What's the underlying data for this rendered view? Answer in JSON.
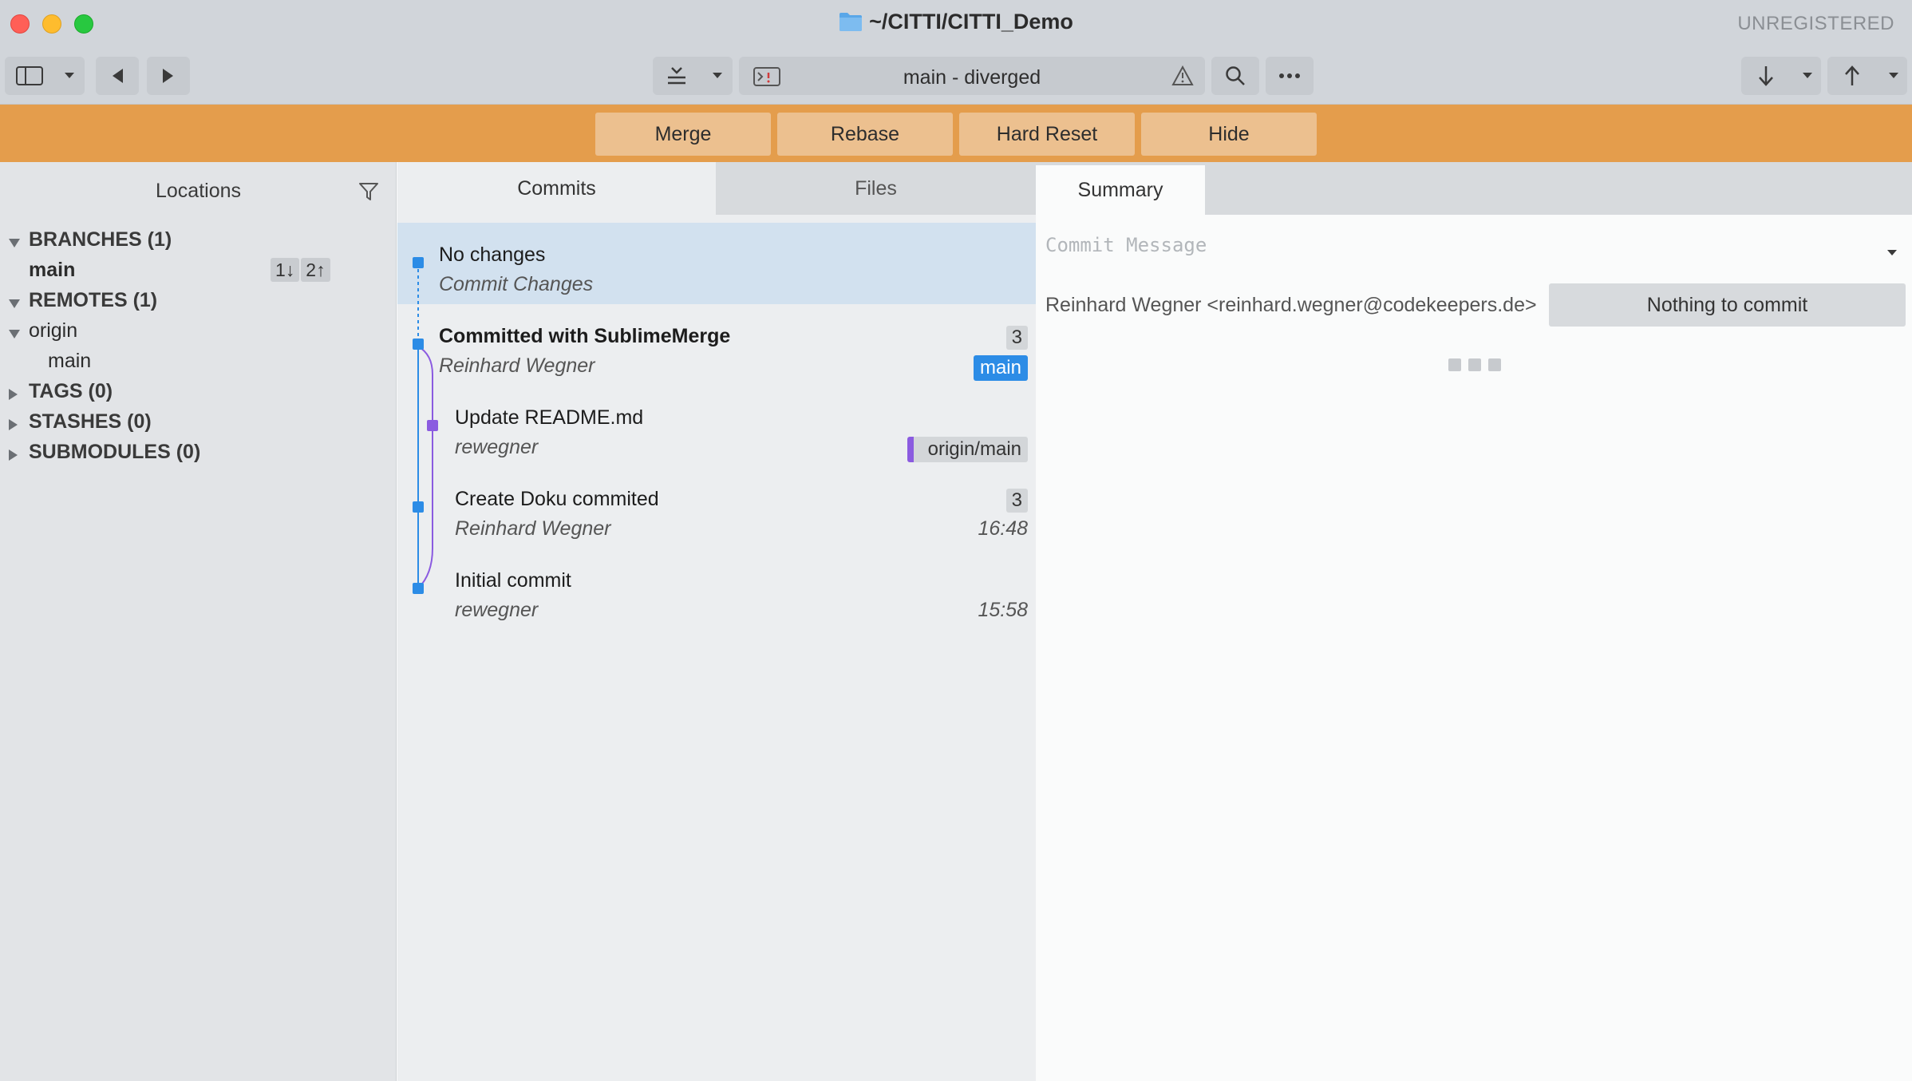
{
  "window": {
    "title": "~/CITTI/CITTI_Demo",
    "registration": "UNREGISTERED"
  },
  "toolbar": {
    "branch_status": "main - diverged",
    "icons": [
      "sidebar-toggle-icon",
      "chevron-down-icon",
      "back-icon",
      "forward-icon",
      "stash-icon",
      "terminal-icon",
      "warning-icon",
      "search-icon",
      "more-icon",
      "pull-icon",
      "push-icon"
    ]
  },
  "actions": {
    "merge": "Merge",
    "rebase": "Rebase",
    "hard_reset": "Hard Reset",
    "hide": "Hide"
  },
  "sidebar": {
    "header": "Locations",
    "branches_label": "BRANCHES (1)",
    "branch_main": "main",
    "behind": "1↓",
    "ahead": "2↑",
    "remotes_label": "REMOTES (1)",
    "remote_origin": "origin",
    "remote_origin_main": "main",
    "tags_label": "TAGS (0)",
    "stashes_label": "STASHES (0)",
    "submodules_label": "SUBMODULES (0)"
  },
  "tabs": {
    "commits": "Commits",
    "files": "Files",
    "summary": "Summary"
  },
  "commits": [
    {
      "title": "No changes",
      "author": "Commit Changes",
      "selected": true
    },
    {
      "title": "Committed with SublimeMerge",
      "author": "Reinhard Wegner",
      "count": "3",
      "ref": "main"
    },
    {
      "title": "Update README.md",
      "author": "rewegner",
      "ref": "origin/main"
    },
    {
      "title": "Create Doku commited",
      "author": "Reinhard Wegner",
      "count": "3",
      "time": "16:48"
    },
    {
      "title": "Initial commit",
      "author": "rewegner",
      "time": "15:58"
    }
  ],
  "summary": {
    "commit_message_placeholder": "Commit Message",
    "identity": "Reinhard Wegner <reinhard.wegner@codekeepers.de>",
    "commit_button": "Nothing to commit"
  },
  "colors": {
    "accent_orange": "#e49d4c",
    "branch_blue": "#2c8ce6",
    "remote_purple": "#8b5be0"
  }
}
